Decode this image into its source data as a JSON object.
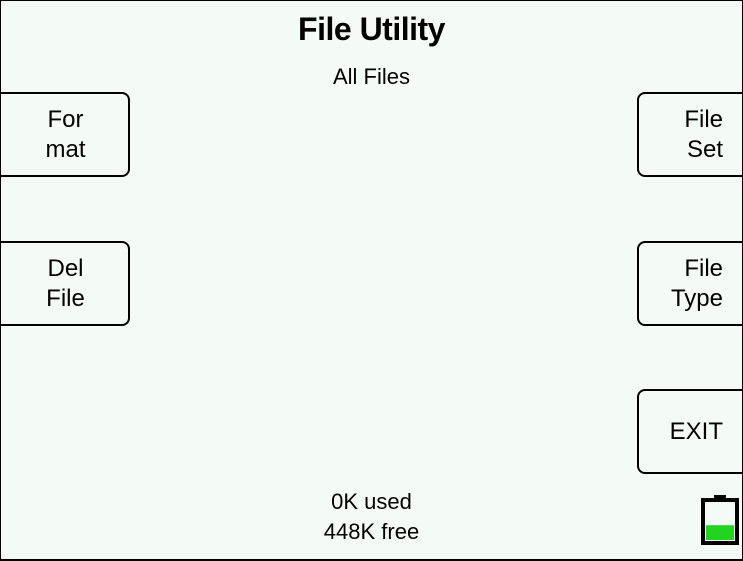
{
  "header": {
    "title": "File Utility",
    "subtitle": "All Files"
  },
  "softkeys": {
    "format": [
      "For",
      "mat"
    ],
    "del_file": [
      "Del",
      "File"
    ],
    "file_set": [
      "File",
      "Set"
    ],
    "file_type": [
      "File",
      "Type"
    ],
    "exit": "EXIT"
  },
  "storage": {
    "used": "0K used",
    "free": "448K free"
  },
  "battery": {
    "icon": "battery-icon",
    "level": 0.4,
    "fill_color": "#22d31f"
  }
}
